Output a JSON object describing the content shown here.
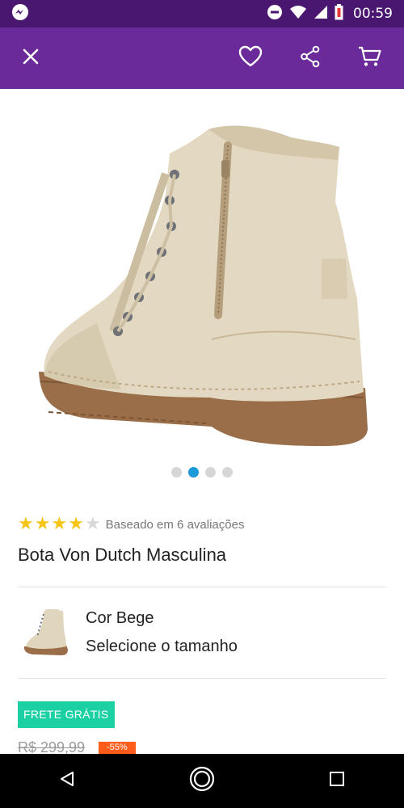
{
  "status_bar": {
    "time": "00:59",
    "icons": [
      "messenger-icon",
      "do-not-disturb-icon",
      "wifi-icon",
      "signal-icon",
      "battery-low-icon"
    ]
  },
  "app_bar": {
    "icons": [
      "close-icon",
      "favorite-icon",
      "share-icon",
      "cart-icon"
    ]
  },
  "carousel": {
    "count": 4,
    "active_index": 1
  },
  "rating": {
    "value": 4,
    "max": 5,
    "text": "Baseado em 6 avaliações"
  },
  "product": {
    "title": "Bota Von Dutch Masculina",
    "color_label": "Cor Bege",
    "size_prompt": "Selecione o tamanho"
  },
  "pricing": {
    "shipping_badge": "FRETE GRÁTIS",
    "old_price": "R$ 299,99",
    "discount": "-55%"
  },
  "colors": {
    "status_bar": "#4a1770",
    "app_bar": "#6b2a9a",
    "star": "#f5c518",
    "dot_active": "#1a9bd8",
    "shipping_badge": "#1bd1a4",
    "discount_badge": "#ff5b1a"
  },
  "nav_bar": {
    "icons": [
      "back-icon",
      "home-icon",
      "recents-icon"
    ]
  }
}
